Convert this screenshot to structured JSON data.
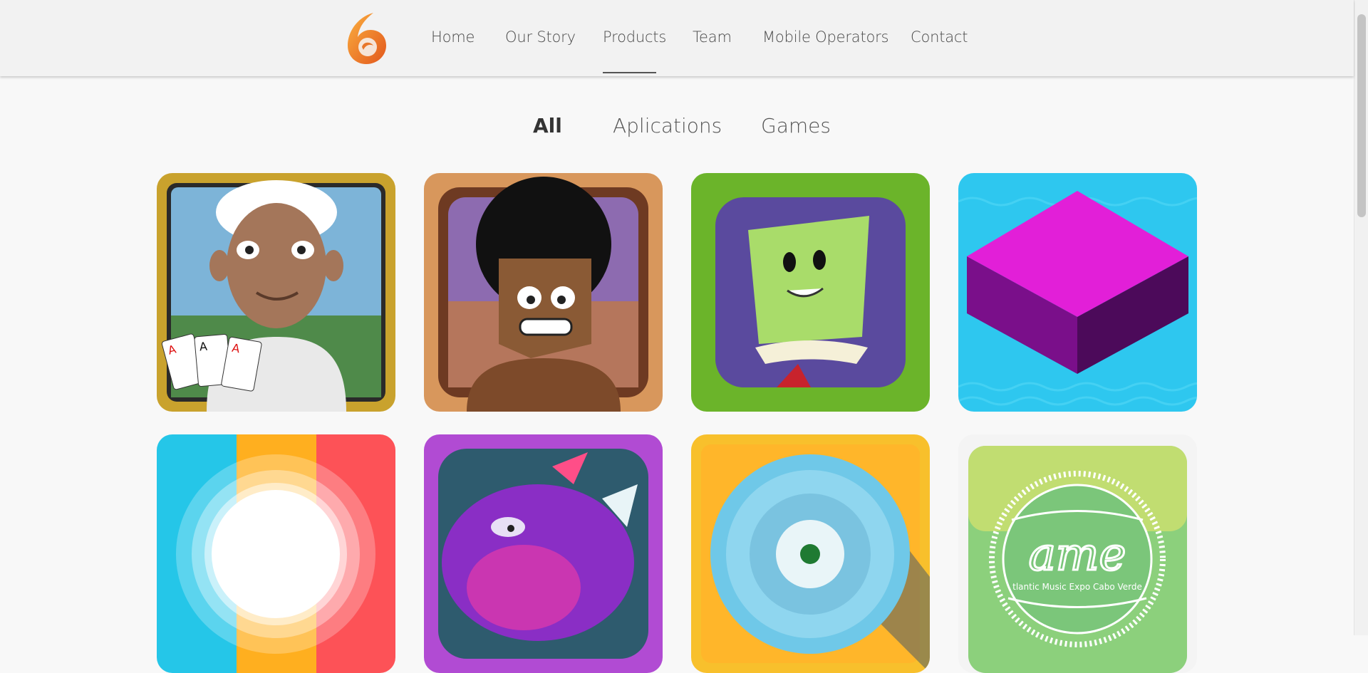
{
  "nav": {
    "items": [
      "Home",
      "Our Story",
      "Products",
      "Team",
      "Mobile Operators",
      "Contact"
    ],
    "active": "Products"
  },
  "filters": {
    "items": [
      "All",
      "Aplications",
      "Games"
    ],
    "active": "All"
  },
  "products": [
    {
      "icon": "card-player-icon"
    },
    {
      "icon": "afro-caveman-icon"
    },
    {
      "icon": "green-monster-icon"
    },
    {
      "icon": "magenta-cube-icon"
    },
    {
      "icon": "color-circle-icon"
    },
    {
      "icon": "purple-crab-icon"
    },
    {
      "icon": "blue-disc-icon"
    },
    {
      "icon": "ame-globe-icon",
      "text": "ame",
      "subtext": "tlantic Music Expo Cabo Verde"
    }
  ],
  "colors": {
    "accent": "#f08a24",
    "nav_bg": "#f2f2f2",
    "page_bg": "#f8f8f8"
  }
}
